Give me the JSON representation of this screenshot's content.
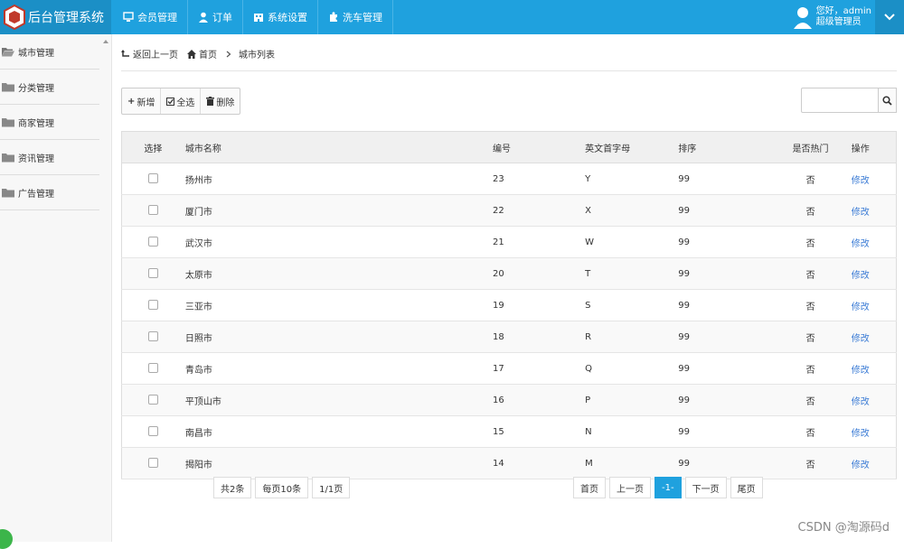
{
  "app": {
    "title": "后台管理系统"
  },
  "nav": [
    {
      "label": "会员管理",
      "icon": "monitor-icon"
    },
    {
      "label": "订单",
      "icon": "user-icon"
    },
    {
      "label": "系统设置",
      "icon": "building-icon"
    },
    {
      "label": "洗车管理",
      "icon": "puzzle-icon"
    }
  ],
  "user": {
    "greeting": "您好，admin",
    "role": "超级管理员"
  },
  "sidebar": {
    "items": [
      {
        "label": "城市管理",
        "icon": "folder-open-icon"
      },
      {
        "label": "分类管理",
        "icon": "folder-icon"
      },
      {
        "label": "商家管理",
        "icon": "folder-icon"
      },
      {
        "label": "资讯管理",
        "icon": "folder-icon"
      },
      {
        "label": "广告管理",
        "icon": "folder-icon"
      }
    ]
  },
  "breadcrumb": {
    "back": "返回上一页",
    "home": "首页",
    "current": "城市列表"
  },
  "toolbar": {
    "add": "新增",
    "select_all": "全选",
    "delete": "删除"
  },
  "search": {
    "value": "",
    "placeholder": ""
  },
  "table": {
    "headers": [
      "选择",
      "城市名称",
      "编号",
      "英文首字母",
      "排序",
      "是否热门",
      "操作"
    ],
    "rows": [
      {
        "name": "扬州市",
        "no": "23",
        "letter": "Y",
        "sort": "99",
        "hot": "否",
        "op": "修改"
      },
      {
        "name": "厦门市",
        "no": "22",
        "letter": "X",
        "sort": "99",
        "hot": "否",
        "op": "修改"
      },
      {
        "name": "武汉市",
        "no": "21",
        "letter": "W",
        "sort": "99",
        "hot": "否",
        "op": "修改"
      },
      {
        "name": "太原市",
        "no": "20",
        "letter": "T",
        "sort": "99",
        "hot": "否",
        "op": "修改"
      },
      {
        "name": "三亚市",
        "no": "19",
        "letter": "S",
        "sort": "99",
        "hot": "否",
        "op": "修改"
      },
      {
        "name": "日照市",
        "no": "18",
        "letter": "R",
        "sort": "99",
        "hot": "否",
        "op": "修改"
      },
      {
        "name": "青岛市",
        "no": "17",
        "letter": "Q",
        "sort": "99",
        "hot": "否",
        "op": "修改"
      },
      {
        "name": "平顶山市",
        "no": "16",
        "letter": "P",
        "sort": "99",
        "hot": "否",
        "op": "修改"
      },
      {
        "name": "南昌市",
        "no": "15",
        "letter": "N",
        "sort": "99",
        "hot": "否",
        "op": "修改"
      },
      {
        "name": "揭阳市",
        "no": "14",
        "letter": "M",
        "sort": "99",
        "hot": "否",
        "op": "修改"
      }
    ]
  },
  "pagination": {
    "total": "共2条",
    "per_page": "每页10条",
    "page_info": "1/1页",
    "first": "首页",
    "prev": "上一页",
    "current": "-1-",
    "next": "下一页",
    "last": "尾页"
  },
  "watermark": "CSDN @淘源码d",
  "colors": {
    "primary": "#1fa1de",
    "brand_bg": "#1b8fc6",
    "link": "#3a7bd5"
  }
}
